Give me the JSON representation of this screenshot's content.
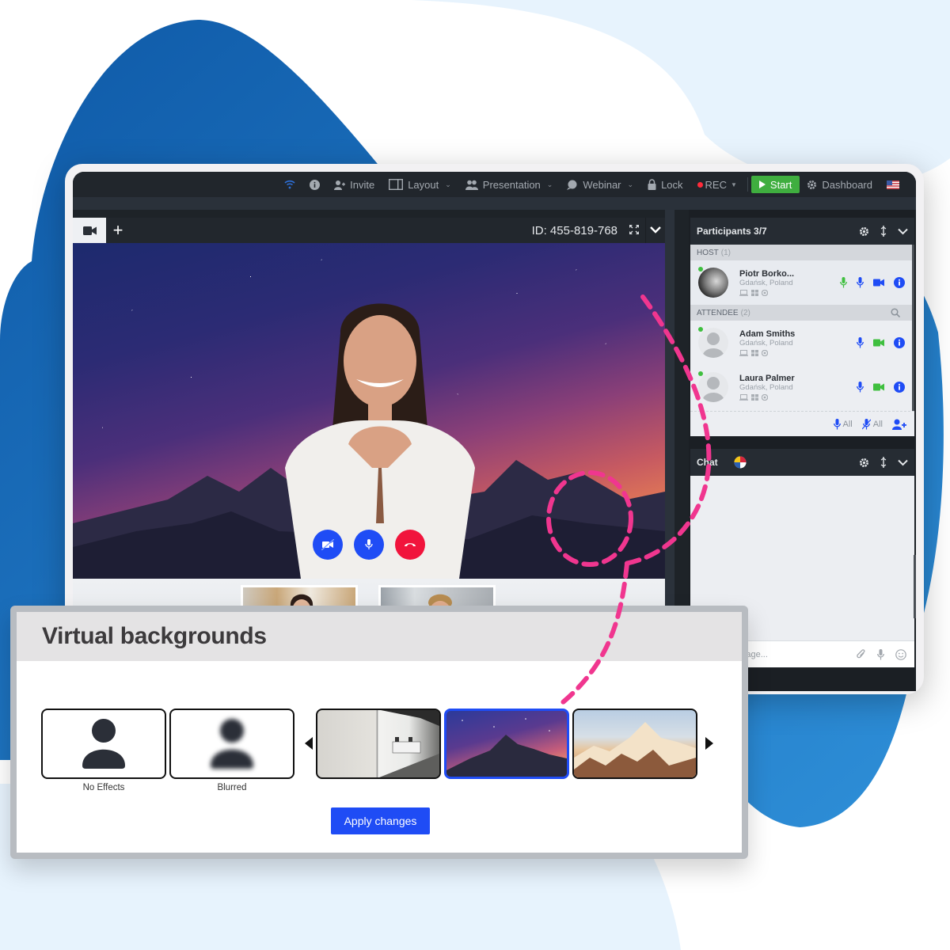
{
  "toolbar": {
    "items": [
      {
        "icon": "wifi-icon",
        "label": ""
      },
      {
        "icon": "info-icon",
        "label": ""
      },
      {
        "icon": "add-user-icon",
        "label": "Invite"
      },
      {
        "icon": "layout-icon",
        "label": "Layout",
        "dropdown": true
      },
      {
        "icon": "presentation-icon",
        "label": "Presentation",
        "dropdown": true
      },
      {
        "icon": "webinar-icon",
        "label": "Webinar",
        "dropdown": true
      },
      {
        "icon": "lock-icon",
        "label": "Lock"
      },
      {
        "icon": "rec-dot-icon",
        "label": "REC",
        "dropdown": true
      }
    ],
    "start_label": "Start",
    "dashboard_label": "Dashboard",
    "language": "en-US"
  },
  "video": {
    "meeting_id": "ID: 455-819-768",
    "tab_add_label": "+",
    "controls": [
      "camera-off",
      "microphone",
      "hang-up"
    ]
  },
  "participants": {
    "title": "Participants 3/7",
    "host_group": {
      "label": "HOST",
      "count": "(1)"
    },
    "attendee_group": {
      "label": "ATTENDEE",
      "count": "(2)"
    },
    "host": {
      "name": "Piotr Borko...",
      "location": "Gdańsk, Poland",
      "online": true
    },
    "attendees": [
      {
        "name": "Adam Smiths",
        "location": "Gdańsk, Poland",
        "online": true
      },
      {
        "name": "Laura Palmer",
        "location": "Gdańsk, Poland",
        "online": true
      }
    ],
    "footer": {
      "unmute_all": "All",
      "mute_all": "All"
    }
  },
  "chat": {
    "title": "Chat",
    "input_placeholder": "Type a message..."
  },
  "virtual_backgrounds": {
    "title": "Virtual backgrounds",
    "options": [
      {
        "label": "No Effects",
        "kind": "none",
        "selected": false
      },
      {
        "label": "Blurred",
        "kind": "blur",
        "selected": false
      },
      {
        "label": "",
        "kind": "office",
        "selected": false
      },
      {
        "label": "",
        "kind": "night-mountain",
        "selected": true
      },
      {
        "label": "",
        "kind": "alpine-peaks",
        "selected": false
      }
    ],
    "apply_label": "Apply changes"
  },
  "colors": {
    "accent_blue": "#1f4cf5",
    "hangup_red": "#f1143c",
    "start_green": "#3fae3f",
    "callout_pink": "#f0368f",
    "backdrop_blue": "#1565b8"
  }
}
